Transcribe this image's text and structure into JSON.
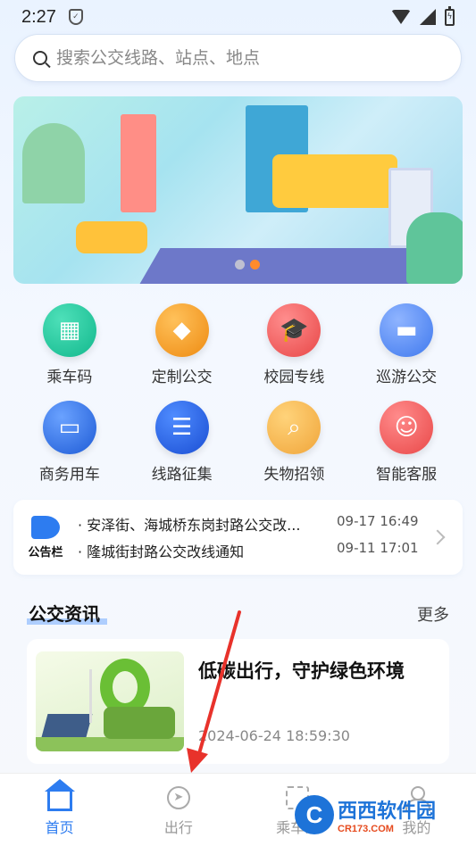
{
  "status": {
    "time": "2:27"
  },
  "search": {
    "placeholder": "搜索公交线路、站点、地点"
  },
  "services": [
    {
      "label": "乘车码",
      "icon": "qr-bus-icon"
    },
    {
      "label": "定制公交",
      "icon": "diamond-icon"
    },
    {
      "label": "校园专线",
      "icon": "graduation-cap-icon"
    },
    {
      "label": "巡游公交",
      "icon": "bus-icon"
    },
    {
      "label": "商务用车",
      "icon": "car-icon"
    },
    {
      "label": "线路征集",
      "icon": "clipboard-icon"
    },
    {
      "label": "失物招领",
      "icon": "lost-found-icon"
    },
    {
      "label": "智能客服",
      "icon": "customer-service-icon"
    }
  ],
  "notice": {
    "badge": "公告栏",
    "items": [
      {
        "title": "· 安泽街、海城桥东岗封路公交改...",
        "date": "09-17 16:49"
      },
      {
        "title": "· 隆城街封路公交改线通知",
        "date": "09-11 17:01"
      }
    ]
  },
  "news": {
    "section_title": "公交资讯",
    "more": "更多",
    "article": {
      "headline": "低碳出行，守护绿色环境",
      "time": "2024-06-24 18:59:30"
    }
  },
  "tabbar": [
    {
      "label": "首页",
      "active": true
    },
    {
      "label": "出行",
      "active": false
    },
    {
      "label": "乘车码",
      "active": false
    },
    {
      "label": "我的",
      "active": false
    }
  ],
  "watermark": {
    "brand": "西西软件园",
    "site": "CR173.COM"
  },
  "colors": {
    "primary": "#2d7cf0",
    "accent_orange": "#ff8b2c"
  }
}
